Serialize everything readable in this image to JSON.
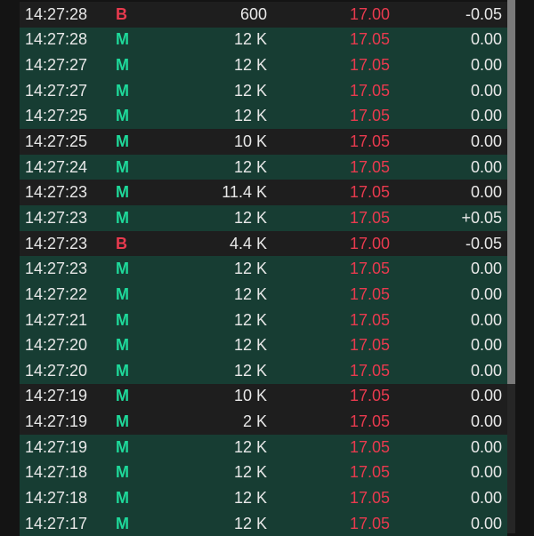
{
  "colors": {
    "buy": "#1ed99a",
    "sell": "#e83a4e",
    "green_row": "#173d33",
    "dark_row": "#1e1e1e"
  },
  "trades": [
    {
      "time": "14:27:28",
      "type": "B",
      "volume": "600",
      "price": "17.00",
      "change": "-0.05",
      "highlight": false
    },
    {
      "time": "14:27:28",
      "type": "M",
      "volume": "12 K",
      "price": "17.05",
      "change": "0.00",
      "highlight": true
    },
    {
      "time": "14:27:27",
      "type": "M",
      "volume": "12 K",
      "price": "17.05",
      "change": "0.00",
      "highlight": true
    },
    {
      "time": "14:27:27",
      "type": "M",
      "volume": "12 K",
      "price": "17.05",
      "change": "0.00",
      "highlight": true
    },
    {
      "time": "14:27:25",
      "type": "M",
      "volume": "12 K",
      "price": "17.05",
      "change": "0.00",
      "highlight": true
    },
    {
      "time": "14:27:25",
      "type": "M",
      "volume": "10 K",
      "price": "17.05",
      "change": "0.00",
      "highlight": false
    },
    {
      "time": "14:27:24",
      "type": "M",
      "volume": "12 K",
      "price": "17.05",
      "change": "0.00",
      "highlight": true
    },
    {
      "time": "14:27:23",
      "type": "M",
      "volume": "11.4 K",
      "price": "17.05",
      "change": "0.00",
      "highlight": false
    },
    {
      "time": "14:27:23",
      "type": "M",
      "volume": "12 K",
      "price": "17.05",
      "change": "+0.05",
      "highlight": true
    },
    {
      "time": "14:27:23",
      "type": "B",
      "volume": "4.4 K",
      "price": "17.00",
      "change": "-0.05",
      "highlight": false
    },
    {
      "time": "14:27:23",
      "type": "M",
      "volume": "12 K",
      "price": "17.05",
      "change": "0.00",
      "highlight": true
    },
    {
      "time": "14:27:22",
      "type": "M",
      "volume": "12 K",
      "price": "17.05",
      "change": "0.00",
      "highlight": true
    },
    {
      "time": "14:27:21",
      "type": "M",
      "volume": "12 K",
      "price": "17.05",
      "change": "0.00",
      "highlight": true
    },
    {
      "time": "14:27:20",
      "type": "M",
      "volume": "12 K",
      "price": "17.05",
      "change": "0.00",
      "highlight": true
    },
    {
      "time": "14:27:20",
      "type": "M",
      "volume": "12 K",
      "price": "17.05",
      "change": "0.00",
      "highlight": true
    },
    {
      "time": "14:27:19",
      "type": "M",
      "volume": "10 K",
      "price": "17.05",
      "change": "0.00",
      "highlight": false
    },
    {
      "time": "14:27:19",
      "type": "M",
      "volume": "2 K",
      "price": "17.05",
      "change": "0.00",
      "highlight": false
    },
    {
      "time": "14:27:19",
      "type": "M",
      "volume": "12 K",
      "price": "17.05",
      "change": "0.00",
      "highlight": true
    },
    {
      "time": "14:27:18",
      "type": "M",
      "volume": "12 K",
      "price": "17.05",
      "change": "0.00",
      "highlight": true
    },
    {
      "time": "14:27:18",
      "type": "M",
      "volume": "12 K",
      "price": "17.05",
      "change": "0.00",
      "highlight": true
    },
    {
      "time": "14:27:17",
      "type": "M",
      "volume": "12 K",
      "price": "17.05",
      "change": "0.00",
      "highlight": true
    }
  ]
}
